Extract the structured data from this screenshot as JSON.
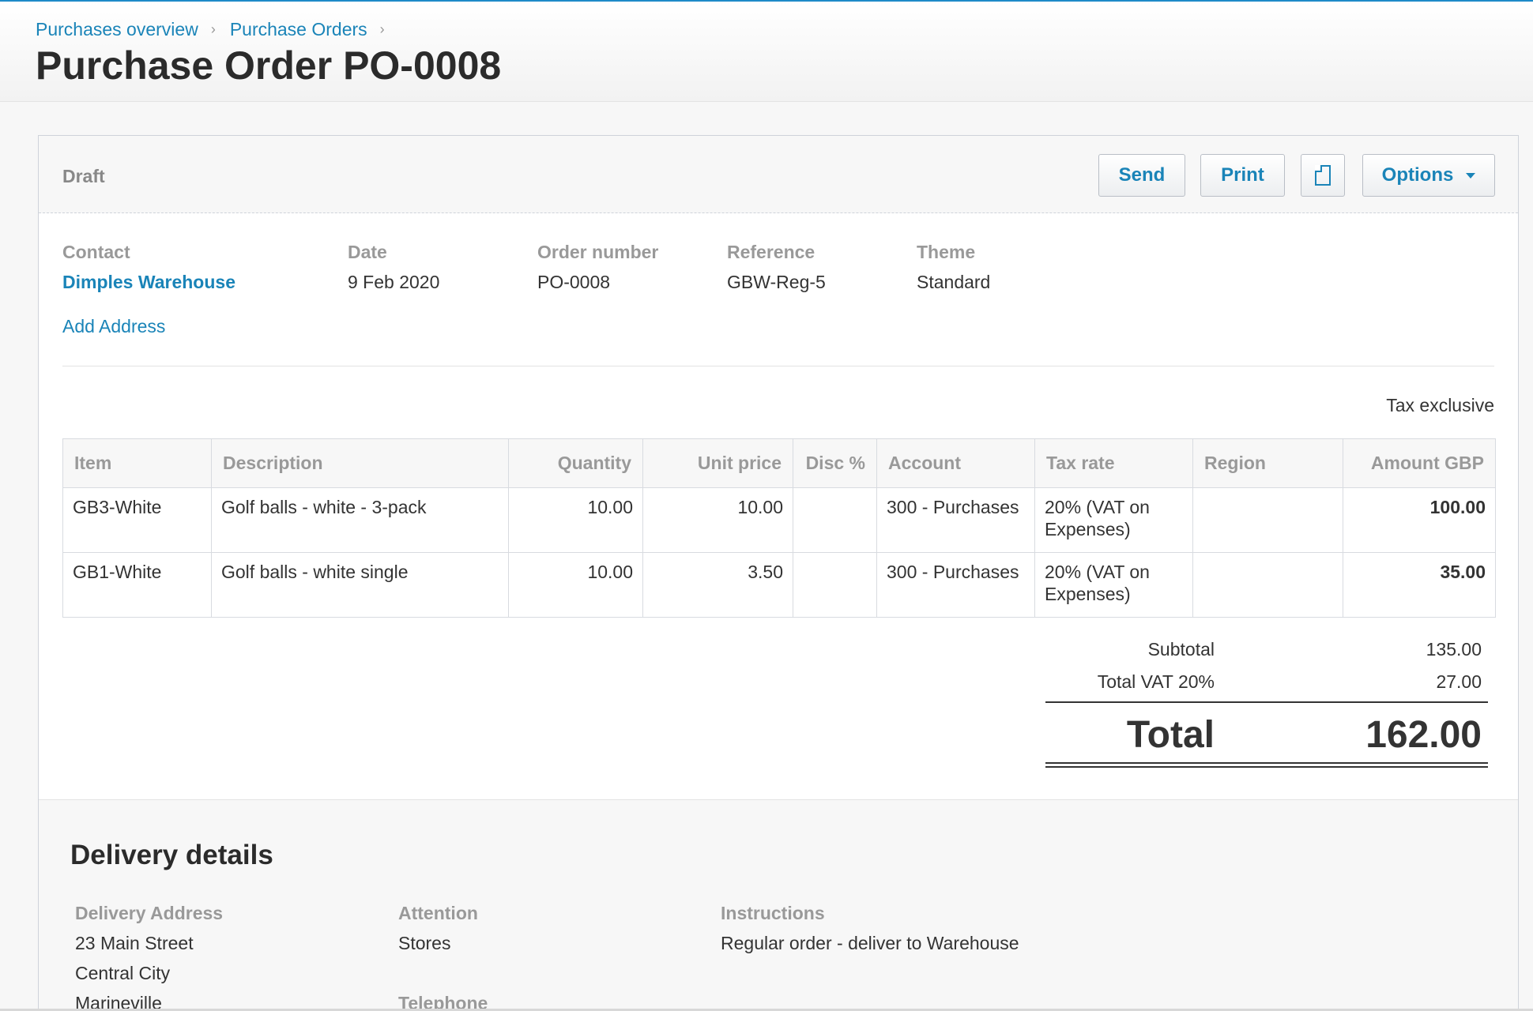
{
  "breadcrumb": [
    "Purchases overview",
    "Purchase Orders"
  ],
  "page_title": "Purchase Order PO-0008",
  "status": "Draft",
  "buttons": {
    "send": "Send",
    "print": "Print",
    "options": "Options"
  },
  "info": {
    "contact_label": "Contact",
    "contact_value": "Dimples Warehouse",
    "date_label": "Date",
    "date_value": "9 Feb 2020",
    "order_number_label": "Order number",
    "order_number_value": "PO-0008",
    "reference_label": "Reference",
    "reference_value": "GBW-Reg-5",
    "theme_label": "Theme",
    "theme_value": "Standard",
    "add_address": "Add Address"
  },
  "tax_mode": "Tax exclusive",
  "table": {
    "headers": [
      "Item",
      "Description",
      "Quantity",
      "Unit price",
      "Disc %",
      "Account",
      "Tax rate",
      "Region",
      "Amount GBP"
    ],
    "rows": [
      {
        "item": "GB3-White",
        "description": "Golf balls - white - 3-pack",
        "quantity": "10.00",
        "unit_price": "10.00",
        "disc": "",
        "account": "300 - Purchases",
        "tax_rate": "20% (VAT on Expenses)",
        "region": "",
        "amount": "100.00"
      },
      {
        "item": "GB1-White",
        "description": "Golf balls - white single",
        "quantity": "10.00",
        "unit_price": "3.50",
        "disc": "",
        "account": "300 - Purchases",
        "tax_rate": "20% (VAT on Expenses)",
        "region": "",
        "amount": "35.00"
      }
    ]
  },
  "totals": {
    "subtotal_label": "Subtotal",
    "subtotal_value": "135.00",
    "vat_label": "Total VAT 20%",
    "vat_value": "27.00",
    "total_label": "Total",
    "total_value": "162.00"
  },
  "delivery": {
    "title": "Delivery details",
    "address_label": "Delivery Address",
    "address_lines": [
      "23 Main Street",
      "Central City",
      "Marineville"
    ],
    "attention_label": "Attention",
    "attention_value": "Stores",
    "telephone_label": "Telephone",
    "instructions_label": "Instructions",
    "instructions_value": "Regular order - deliver to Warehouse"
  },
  "colors": {
    "accent": "#1a84b8",
    "text": "#333333",
    "muted": "#999999"
  }
}
